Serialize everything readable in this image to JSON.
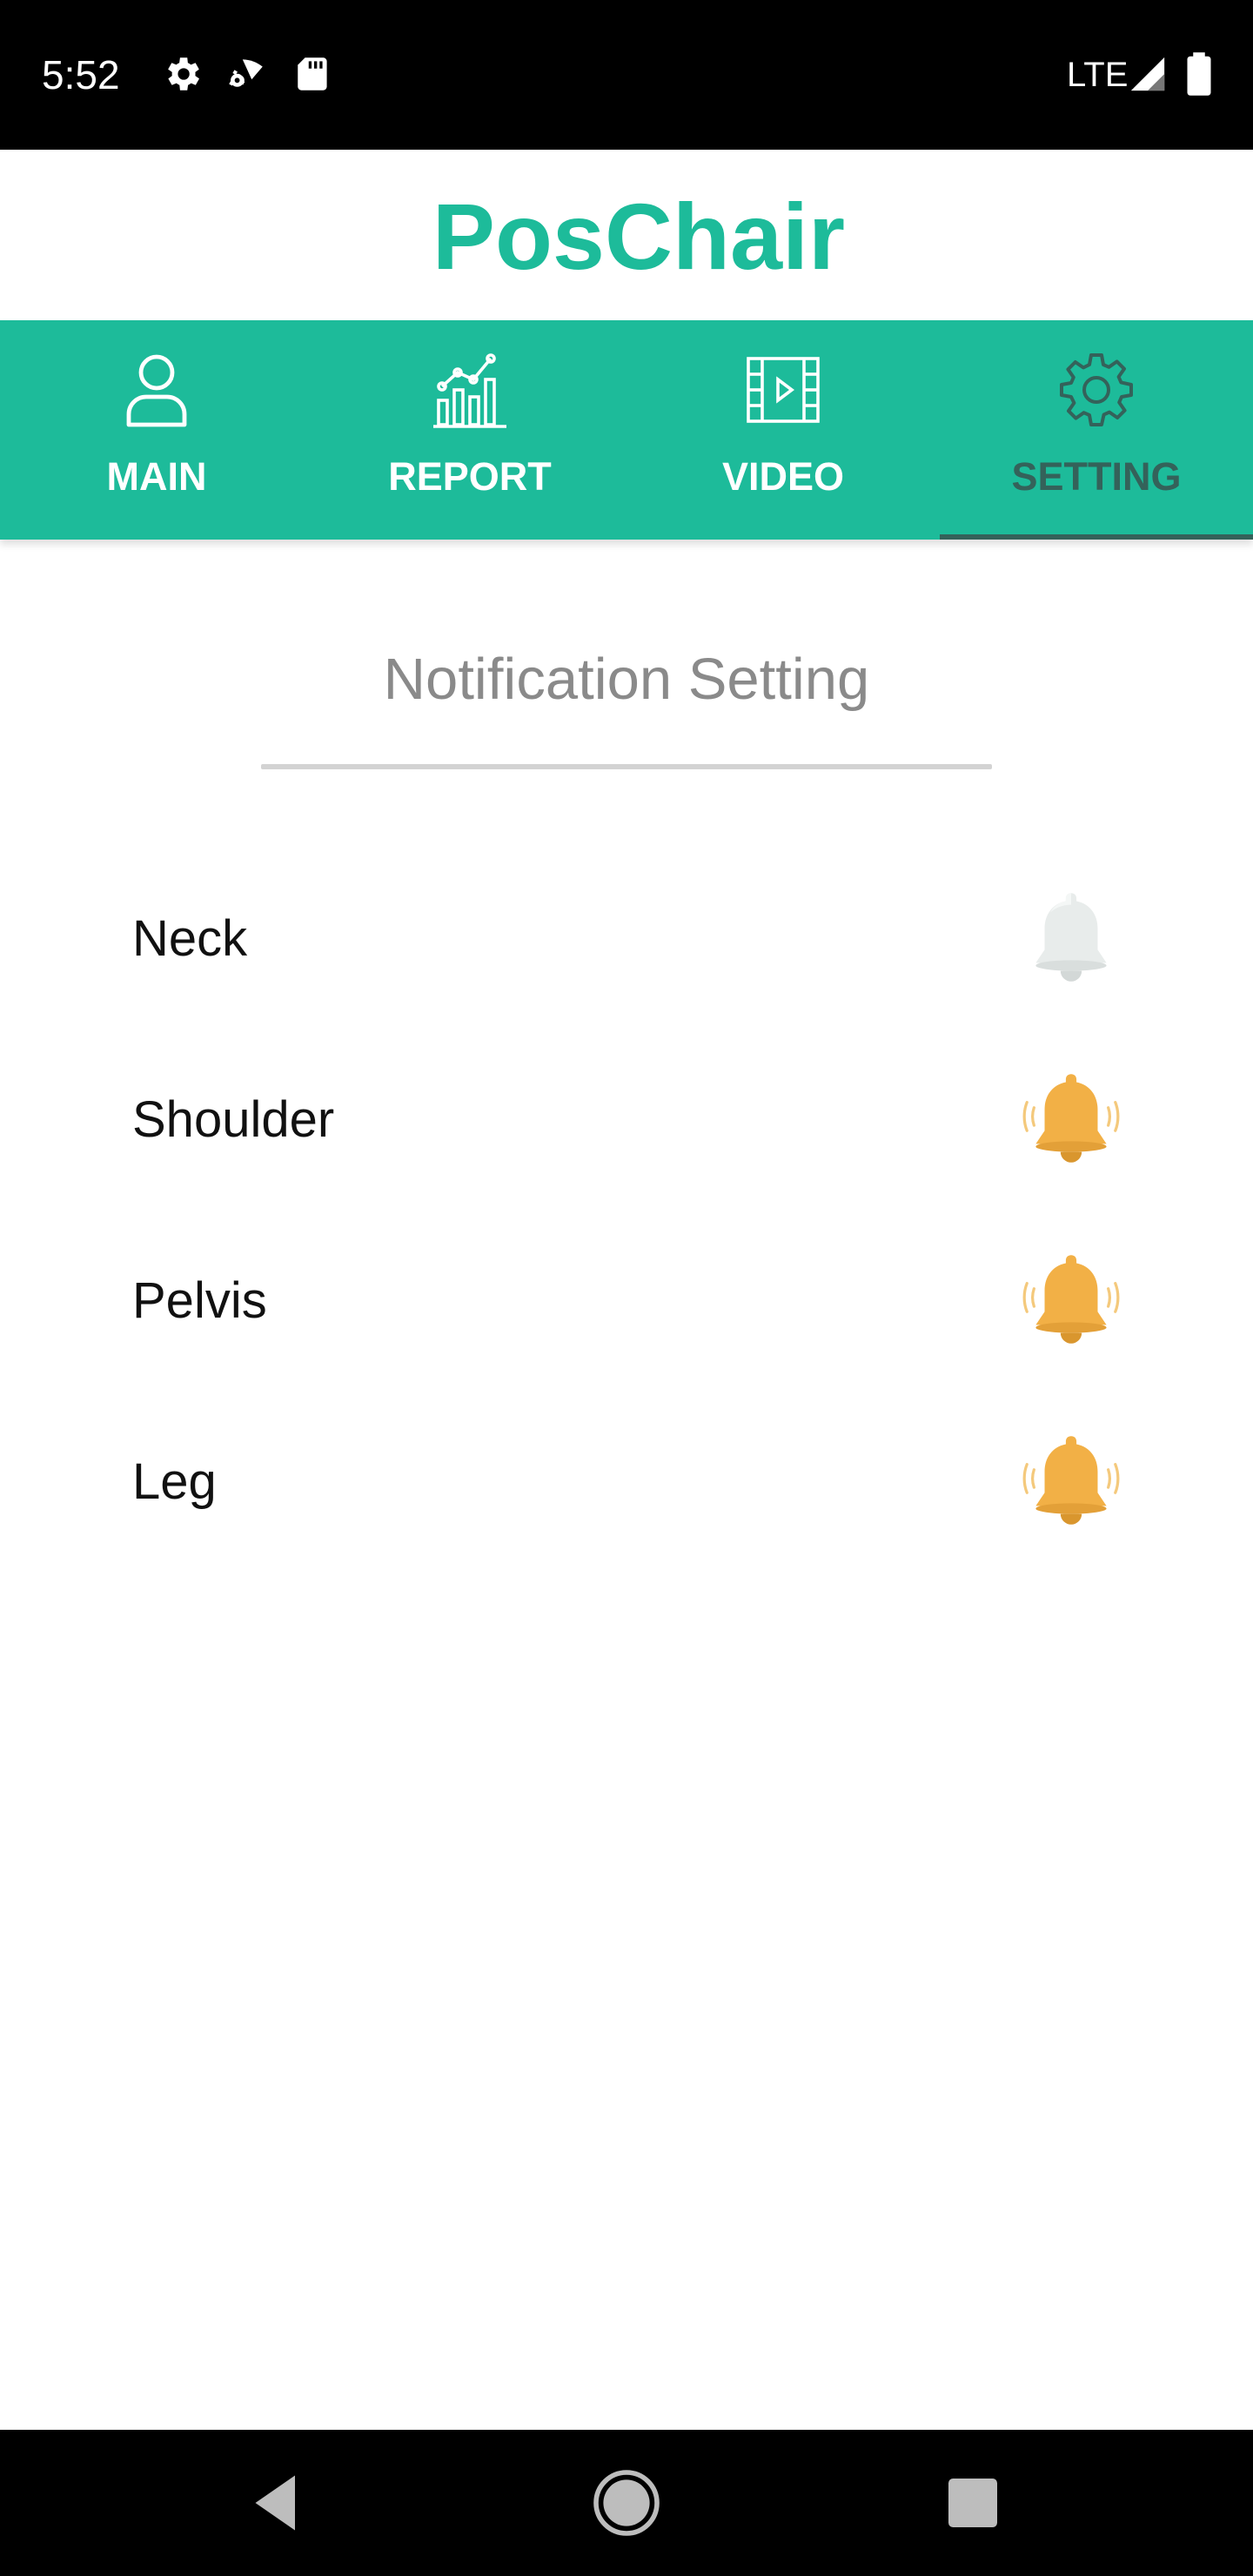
{
  "status_bar": {
    "time": "5:52",
    "icons": [
      "gear-icon",
      "wifi-cast-icon",
      "sd-card-icon"
    ],
    "network": "LTE",
    "right_icons": [
      "signal-icon",
      "battery-icon"
    ]
  },
  "app": {
    "title": "PosChair",
    "brand_color": "#1dbb9a",
    "active_tab_color": "#34625a"
  },
  "tabs": [
    {
      "label": "MAIN",
      "icon": "user-icon",
      "active": false
    },
    {
      "label": "REPORT",
      "icon": "chart-icon",
      "active": false
    },
    {
      "label": "VIDEO",
      "icon": "film-icon",
      "active": false
    },
    {
      "label": "SETTING",
      "icon": "gear-icon",
      "active": true
    }
  ],
  "section": {
    "title": "Notification Setting"
  },
  "settings": [
    {
      "label": "Neck",
      "notification": "off",
      "icon": "bell-off-icon"
    },
    {
      "label": "Shoulder",
      "notification": "on",
      "icon": "bell-ringing-icon"
    },
    {
      "label": "Pelvis",
      "notification": "on",
      "icon": "bell-ringing-icon"
    },
    {
      "label": "Leg",
      "notification": "on",
      "icon": "bell-ringing-icon"
    }
  ],
  "nav_bar": {
    "buttons": [
      "back-icon",
      "home-icon",
      "recents-icon"
    ]
  }
}
